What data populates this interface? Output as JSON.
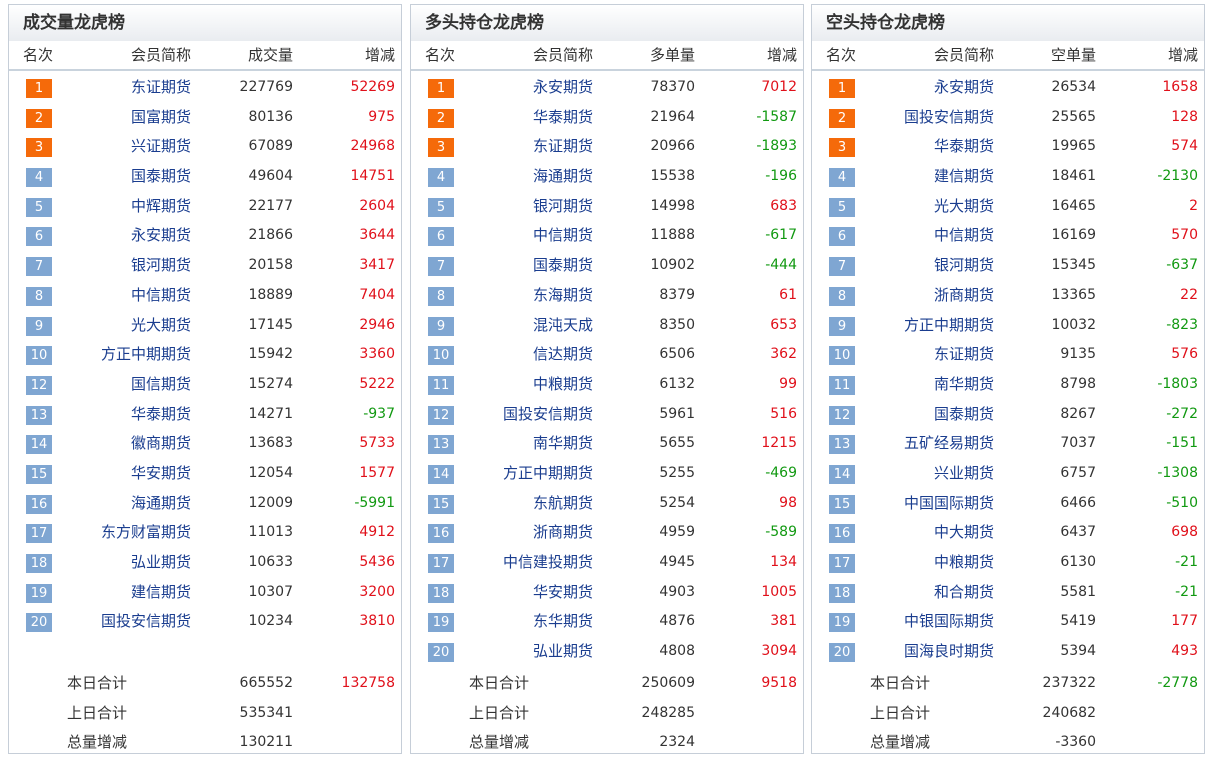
{
  "panels": [
    {
      "title": "成交量龙虎榜",
      "headers": {
        "rank": "名次",
        "name": "会员简称",
        "vol": "成交量",
        "chg": "增减"
      },
      "rows": [
        {
          "rank": "1",
          "name": "东证期货",
          "vol": "227769",
          "chg": "52269"
        },
        {
          "rank": "2",
          "name": "国富期货",
          "vol": "80136",
          "chg": "975"
        },
        {
          "rank": "3",
          "name": "兴证期货",
          "vol": "67089",
          "chg": "24968"
        },
        {
          "rank": "4",
          "name": "国泰期货",
          "vol": "49604",
          "chg": "14751"
        },
        {
          "rank": "5",
          "name": "中辉期货",
          "vol": "22177",
          "chg": "2604"
        },
        {
          "rank": "6",
          "name": "永安期货",
          "vol": "21866",
          "chg": "3644"
        },
        {
          "rank": "7",
          "name": "银河期货",
          "vol": "20158",
          "chg": "3417"
        },
        {
          "rank": "8",
          "name": "中信期货",
          "vol": "18889",
          "chg": "7404"
        },
        {
          "rank": "9",
          "name": "光大期货",
          "vol": "17145",
          "chg": "2946"
        },
        {
          "rank": "10",
          "name": "方正中期期货",
          "vol": "15942",
          "chg": "3360"
        },
        {
          "rank": "12",
          "name": "国信期货",
          "vol": "15274",
          "chg": "5222"
        },
        {
          "rank": "13",
          "name": "华泰期货",
          "vol": "14271",
          "chg": "-937"
        },
        {
          "rank": "14",
          "name": "徽商期货",
          "vol": "13683",
          "chg": "5733"
        },
        {
          "rank": "15",
          "name": "华安期货",
          "vol": "12054",
          "chg": "1577"
        },
        {
          "rank": "16",
          "name": "海通期货",
          "vol": "12009",
          "chg": "-5991"
        },
        {
          "rank": "17",
          "name": "东方财富期货",
          "vol": "11013",
          "chg": "4912"
        },
        {
          "rank": "18",
          "name": "弘业期货",
          "vol": "10633",
          "chg": "5436"
        },
        {
          "rank": "19",
          "name": "建信期货",
          "vol": "10307",
          "chg": "3200"
        },
        {
          "rank": "20",
          "name": "国投安信期货",
          "vol": "10234",
          "chg": "3810"
        }
      ],
      "summary": [
        {
          "label": "本日合计",
          "vol": "665552",
          "chg": "132758"
        },
        {
          "label": "上日合计",
          "vol": "535341",
          "chg": ""
        },
        {
          "label": "总量增减",
          "vol": "130211",
          "chg": ""
        }
      ]
    },
    {
      "title": "多头持仓龙虎榜",
      "headers": {
        "rank": "名次",
        "name": "会员简称",
        "vol": "多单量",
        "chg": "增减"
      },
      "rows": [
        {
          "rank": "1",
          "name": "永安期货",
          "vol": "78370",
          "chg": "7012"
        },
        {
          "rank": "2",
          "name": "华泰期货",
          "vol": "21964",
          "chg": "-1587"
        },
        {
          "rank": "3",
          "name": "东证期货",
          "vol": "20966",
          "chg": "-1893"
        },
        {
          "rank": "4",
          "name": "海通期货",
          "vol": "15538",
          "chg": "-196"
        },
        {
          "rank": "5",
          "name": "银河期货",
          "vol": "14998",
          "chg": "683"
        },
        {
          "rank": "6",
          "name": "中信期货",
          "vol": "11888",
          "chg": "-617"
        },
        {
          "rank": "7",
          "name": "国泰期货",
          "vol": "10902",
          "chg": "-444"
        },
        {
          "rank": "8",
          "name": "东海期货",
          "vol": "8379",
          "chg": "61"
        },
        {
          "rank": "9",
          "name": "混沌天成",
          "vol": "8350",
          "chg": "653"
        },
        {
          "rank": "10",
          "name": "信达期货",
          "vol": "6506",
          "chg": "362"
        },
        {
          "rank": "11",
          "name": "中粮期货",
          "vol": "6132",
          "chg": "99"
        },
        {
          "rank": "12",
          "name": "国投安信期货",
          "vol": "5961",
          "chg": "516"
        },
        {
          "rank": "13",
          "name": "南华期货",
          "vol": "5655",
          "chg": "1215"
        },
        {
          "rank": "14",
          "name": "方正中期期货",
          "vol": "5255",
          "chg": "-469"
        },
        {
          "rank": "15",
          "name": "东航期货",
          "vol": "5254",
          "chg": "98"
        },
        {
          "rank": "16",
          "name": "浙商期货",
          "vol": "4959",
          "chg": "-589"
        },
        {
          "rank": "17",
          "name": "中信建投期货",
          "vol": "4945",
          "chg": "134"
        },
        {
          "rank": "18",
          "name": "华安期货",
          "vol": "4903",
          "chg": "1005"
        },
        {
          "rank": "19",
          "name": "东华期货",
          "vol": "4876",
          "chg": "381"
        },
        {
          "rank": "20",
          "name": "弘业期货",
          "vol": "4808",
          "chg": "3094"
        }
      ],
      "summary": [
        {
          "label": "本日合计",
          "vol": "250609",
          "chg": "9518"
        },
        {
          "label": "上日合计",
          "vol": "248285",
          "chg": ""
        },
        {
          "label": "总量增减",
          "vol": "2324",
          "chg": ""
        }
      ]
    },
    {
      "title": "空头持仓龙虎榜",
      "headers": {
        "rank": "名次",
        "name": "会员简称",
        "vol": "空单量",
        "chg": "增减"
      },
      "rows": [
        {
          "rank": "1",
          "name": "永安期货",
          "vol": "26534",
          "chg": "1658"
        },
        {
          "rank": "2",
          "name": "国投安信期货",
          "vol": "25565",
          "chg": "128"
        },
        {
          "rank": "3",
          "name": "华泰期货",
          "vol": "19965",
          "chg": "574"
        },
        {
          "rank": "4",
          "name": "建信期货",
          "vol": "18461",
          "chg": "-2130"
        },
        {
          "rank": "5",
          "name": "光大期货",
          "vol": "16465",
          "chg": "2"
        },
        {
          "rank": "6",
          "name": "中信期货",
          "vol": "16169",
          "chg": "570"
        },
        {
          "rank": "7",
          "name": "银河期货",
          "vol": "15345",
          "chg": "-637"
        },
        {
          "rank": "8",
          "name": "浙商期货",
          "vol": "13365",
          "chg": "22"
        },
        {
          "rank": "9",
          "name": "方正中期期货",
          "vol": "10032",
          "chg": "-823"
        },
        {
          "rank": "10",
          "name": "东证期货",
          "vol": "9135",
          "chg": "576"
        },
        {
          "rank": "11",
          "name": "南华期货",
          "vol": "8798",
          "chg": "-1803"
        },
        {
          "rank": "12",
          "name": "国泰期货",
          "vol": "8267",
          "chg": "-272"
        },
        {
          "rank": "13",
          "name": "五矿经易期货",
          "vol": "7037",
          "chg": "-151"
        },
        {
          "rank": "14",
          "name": "兴业期货",
          "vol": "6757",
          "chg": "-1308"
        },
        {
          "rank": "15",
          "name": "中国国际期货",
          "vol": "6466",
          "chg": "-510"
        },
        {
          "rank": "16",
          "name": "中大期货",
          "vol": "6437",
          "chg": "698"
        },
        {
          "rank": "17",
          "name": "中粮期货",
          "vol": "6130",
          "chg": "-21"
        },
        {
          "rank": "18",
          "name": "和合期货",
          "vol": "5581",
          "chg": "-21"
        },
        {
          "rank": "19",
          "name": "中银国际期货",
          "vol": "5419",
          "chg": "177"
        },
        {
          "rank": "20",
          "name": "国海良时期货",
          "vol": "5394",
          "chg": "493"
        }
      ],
      "summary": [
        {
          "label": "本日合计",
          "vol": "237322",
          "chg": "-2778"
        },
        {
          "label": "上日合计",
          "vol": "240682",
          "chg": ""
        },
        {
          "label": "总量增减",
          "vol": "-3360",
          "chg": ""
        }
      ]
    }
  ],
  "colors": {
    "top_badge": "#f56a0a",
    "badge": "#7fa6d2",
    "positive": "#e0101a",
    "negative": "#119911",
    "member_name": "#1a3d8f"
  }
}
